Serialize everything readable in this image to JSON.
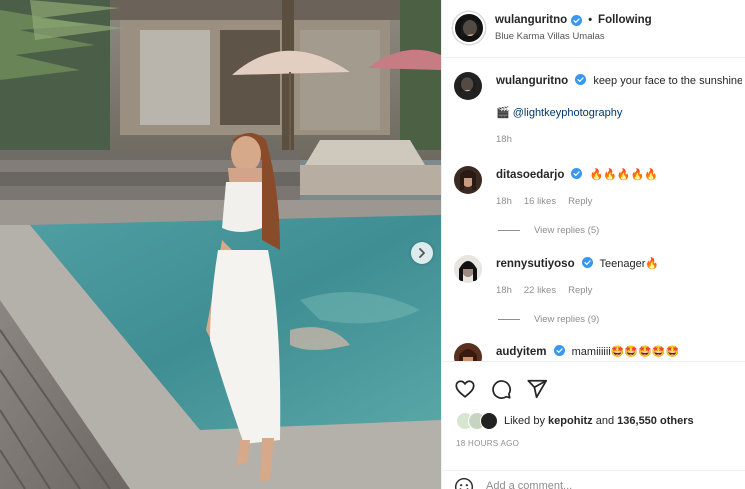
{
  "header": {
    "username": "wulanguritno",
    "separator": "•",
    "follow_label": "Following",
    "location": "Blue Karma Villas Umalas"
  },
  "caption": {
    "username": "wulanguritno",
    "text": "keep your face to the sunshine",
    "emoji": "🌻",
    "credit_prefix": "🎬",
    "credit_link": "@lightkeyphotography",
    "time": "18h"
  },
  "comments": [
    {
      "username": "ditasoedarjo",
      "text": "🔥🔥🔥🔥🔥",
      "time": "18h",
      "likes": "16 likes",
      "reply_label": "Reply",
      "view_replies": "View replies (5)"
    },
    {
      "username": "rennysutiyoso",
      "text": "Teenager🔥",
      "time": "18h",
      "likes": "22 likes",
      "reply_label": "Reply",
      "view_replies": "View replies (9)"
    },
    {
      "username": "audyitem",
      "text": "mamiiiiii🤩🤩🤩🤩🤩"
    }
  ],
  "actions": {
    "like_icon": "heart-icon",
    "comment_icon": "comment-icon",
    "share_icon": "share-icon"
  },
  "likes": {
    "prefix": "Liked by",
    "user": "kepohitz",
    "conjunction": "and",
    "count": "136,550 others"
  },
  "timestamp": "18 HOURS AGO",
  "add_comment": {
    "placeholder": "Add a comment...",
    "emoji_icon": "smiley-icon"
  },
  "colors": {
    "verified": "#3897f0",
    "link": "#00376b",
    "muted": "#8e8e8e",
    "text": "#262626"
  }
}
